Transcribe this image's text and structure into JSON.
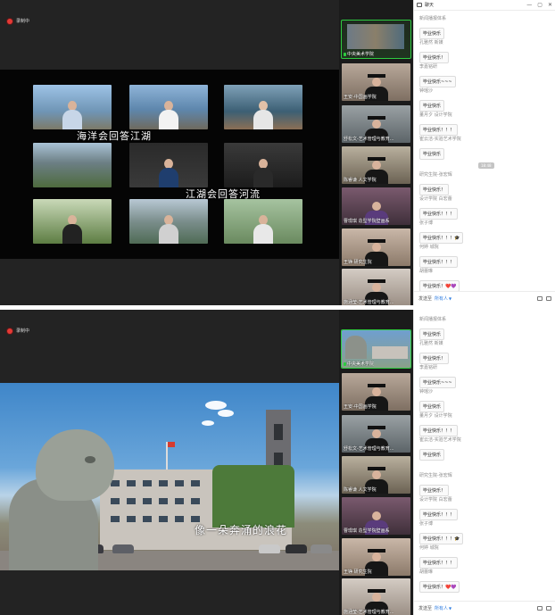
{
  "recording": {
    "label": "录制中"
  },
  "chat": {
    "title": "聊天",
    "send_to_label": "发送至",
    "recipient": "所有人",
    "timestamp": "18:48",
    "messages": [
      {
        "sender": "新闻播报体系",
        "text": "毕业快乐"
      },
      {
        "sender": "孔雅然 新媒",
        "text": "毕业快乐！"
      },
      {
        "sender": "李嘉铭研",
        "text": "毕业快乐~~~"
      },
      {
        "sender": "钟瑶沙",
        "text": "毕业快乐"
      },
      {
        "sender": "董月夕 设计学院",
        "text": "毕业快乐！！！"
      },
      {
        "sender": "崔云洁-实验艺术学院",
        "text": "毕业快乐"
      },
      {
        "sender": "研究生院-张宏辉",
        "text": "毕业快乐！"
      },
      {
        "sender": "设计学院 白宏蕾",
        "text": "毕业快乐！！！"
      },
      {
        "sender": "张子博",
        "text": "毕业快乐！！！🎓"
      },
      {
        "sender": "何婷 城院",
        "text": "毕业快乐！！！"
      },
      {
        "sender": "胡蕾琳",
        "text": "毕业快乐！❤️💜"
      }
    ]
  },
  "participants": [
    {
      "name": "中央美术学院",
      "active": true
    },
    {
      "name": "王安-中国画学院"
    },
    {
      "name": "舒松文-艺术管理与教育..."
    },
    {
      "name": "陈睿谦 人文学院"
    },
    {
      "name": "曹璟琪 造型学院壁画系"
    },
    {
      "name": "王铮 研究生院"
    },
    {
      "name": "施涵莹-艺术管理与教育..."
    }
  ],
  "top_shot": {
    "captions": [
      "海洋会回答江湖",
      "江湖会回答河流"
    ]
  },
  "bottom_shot": {
    "subtitle": "像一朵奔涌的浪花"
  },
  "colors": {
    "accent_green": "#2ecc40",
    "record_red": "#e53935",
    "link_blue": "#2f7de1"
  }
}
